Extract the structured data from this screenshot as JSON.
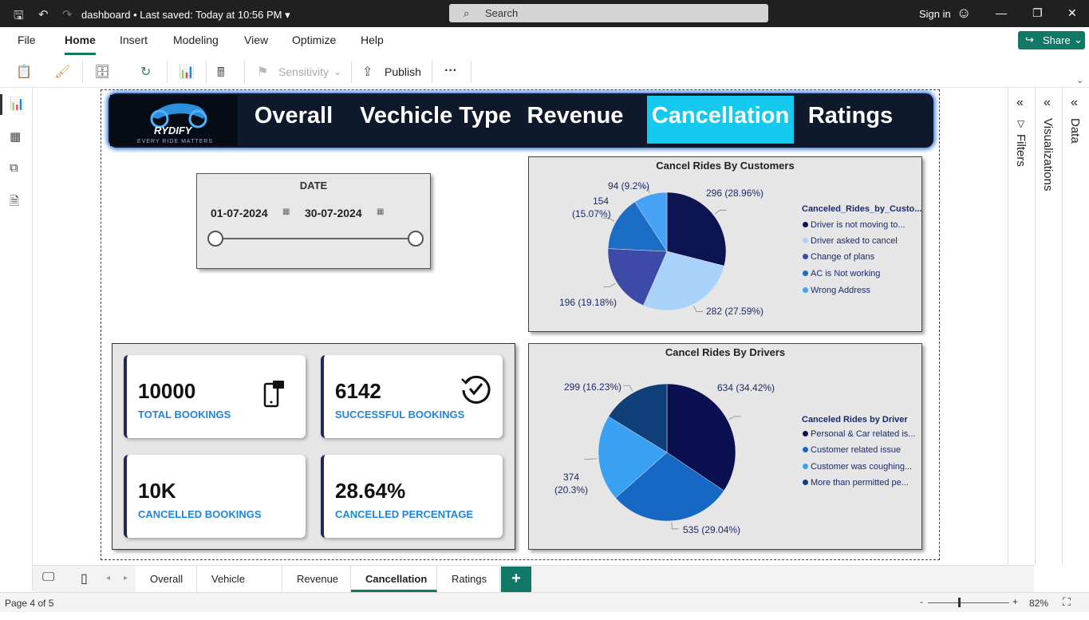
{
  "titlebar": {
    "filename": "dashboard",
    "saved": "•  Last saved: Today at 10:56 PM",
    "search_placeholder": "Search",
    "signin": "Sign in"
  },
  "menu": {
    "items": [
      "File",
      "Home",
      "Insert",
      "Modeling",
      "View",
      "Optimize",
      "Help"
    ],
    "active": "Home",
    "share": "Share"
  },
  "toolbar": {
    "sensitivity": "Sensitivity",
    "publish": "Publish",
    "more": "···"
  },
  "nav": {
    "logo_text": "RYDIFY",
    "logo_tagline": "EVERY RIDE MATTERS",
    "items": [
      "Overall",
      "Vechicle Type",
      "Revenue",
      "Cancellation",
      "Ratings"
    ],
    "selected": "Cancellation"
  },
  "date_slicer": {
    "title": "DATE",
    "start": "01-07-2024",
    "end": "30-07-2024"
  },
  "kpis": [
    {
      "value": "10000",
      "label": "TOTAL BOOKINGS",
      "icon": "phone-booking-icon"
    },
    {
      "value": "6142",
      "label": "SUCCESSFUL BOOKINGS",
      "icon": "success-check-icon"
    },
    {
      "value": "10K",
      "label": "CANCELLED BOOKINGS"
    },
    {
      "value": "28.64%",
      "label": "CANCELLED PERCENTAGE"
    }
  ],
  "chart_data": [
    {
      "type": "pie",
      "title": "Cancel Rides By Customers",
      "legend_title": "Canceled_Rides_by_Custo...",
      "categories": [
        "Driver is not moving to...",
        "Driver asked to cancel",
        "Change of plans",
        "AC is Not working",
        "Wrong Address"
      ],
      "values": [
        296,
        282,
        196,
        154,
        94
      ],
      "labels": [
        "296 (28.96%)",
        "282 (27.59%)",
        "196 (19.18%)",
        "154 (15.07%)",
        "94 (9.2%)"
      ],
      "colors": [
        "#0d1452",
        "#a9d2fb",
        "#3d4aa8",
        "#1a6cc4",
        "#45a2f5"
      ],
      "legend_position": "right"
    },
    {
      "type": "pie",
      "title": "Cancel Rides By Drivers",
      "legend_title": "Canceled Rides by Driver",
      "categories": [
        "Personal & Car related is...",
        "Customer related issue",
        "Customer was coughing...",
        "More than permitted pe..."
      ],
      "values": [
        634,
        535,
        374,
        299
      ],
      "labels": [
        "634 (34.42%)",
        "535 (29.04%)",
        "374 (20.3%)",
        "299 (16.23%)"
      ],
      "colors": [
        "#0b1150",
        "#1668c4",
        "#3aa0f2",
        "#0e3f78"
      ],
      "legend_position": "right"
    }
  ],
  "pages": {
    "tabs": [
      "Overall",
      "Vehicle Type",
      "Revenue",
      "Cancellation",
      "Ratings"
    ],
    "selected": "Cancellation",
    "add": "+"
  },
  "status": {
    "page": "Page 4 of 5",
    "zoom": "82%"
  },
  "panes": {
    "filters": "Filters",
    "visualizations": "Visualizations",
    "data": "Data"
  }
}
